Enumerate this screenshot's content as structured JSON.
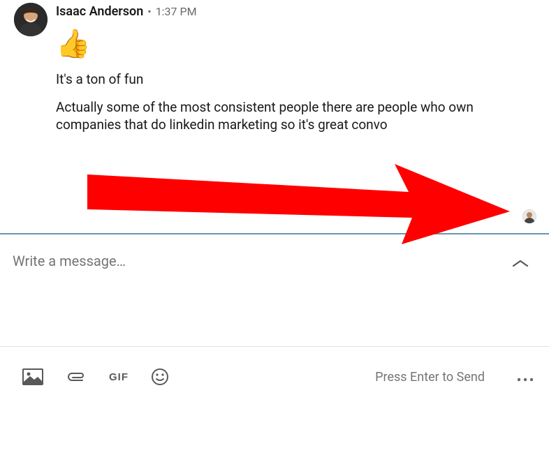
{
  "message": {
    "sender_name": "Isaac Anderson",
    "separator": "•",
    "timestamp": "1:37 PM",
    "emoji": "👍",
    "text1": "It's a ton of fun",
    "text2": "Actually some of the most consistent people there are people who own companies that do linkedin marketing so it's great convo"
  },
  "composer": {
    "placeholder": "Write a message…"
  },
  "toolbar": {
    "gif_label": "GIF",
    "send_hint": "Press Enter to Send"
  }
}
